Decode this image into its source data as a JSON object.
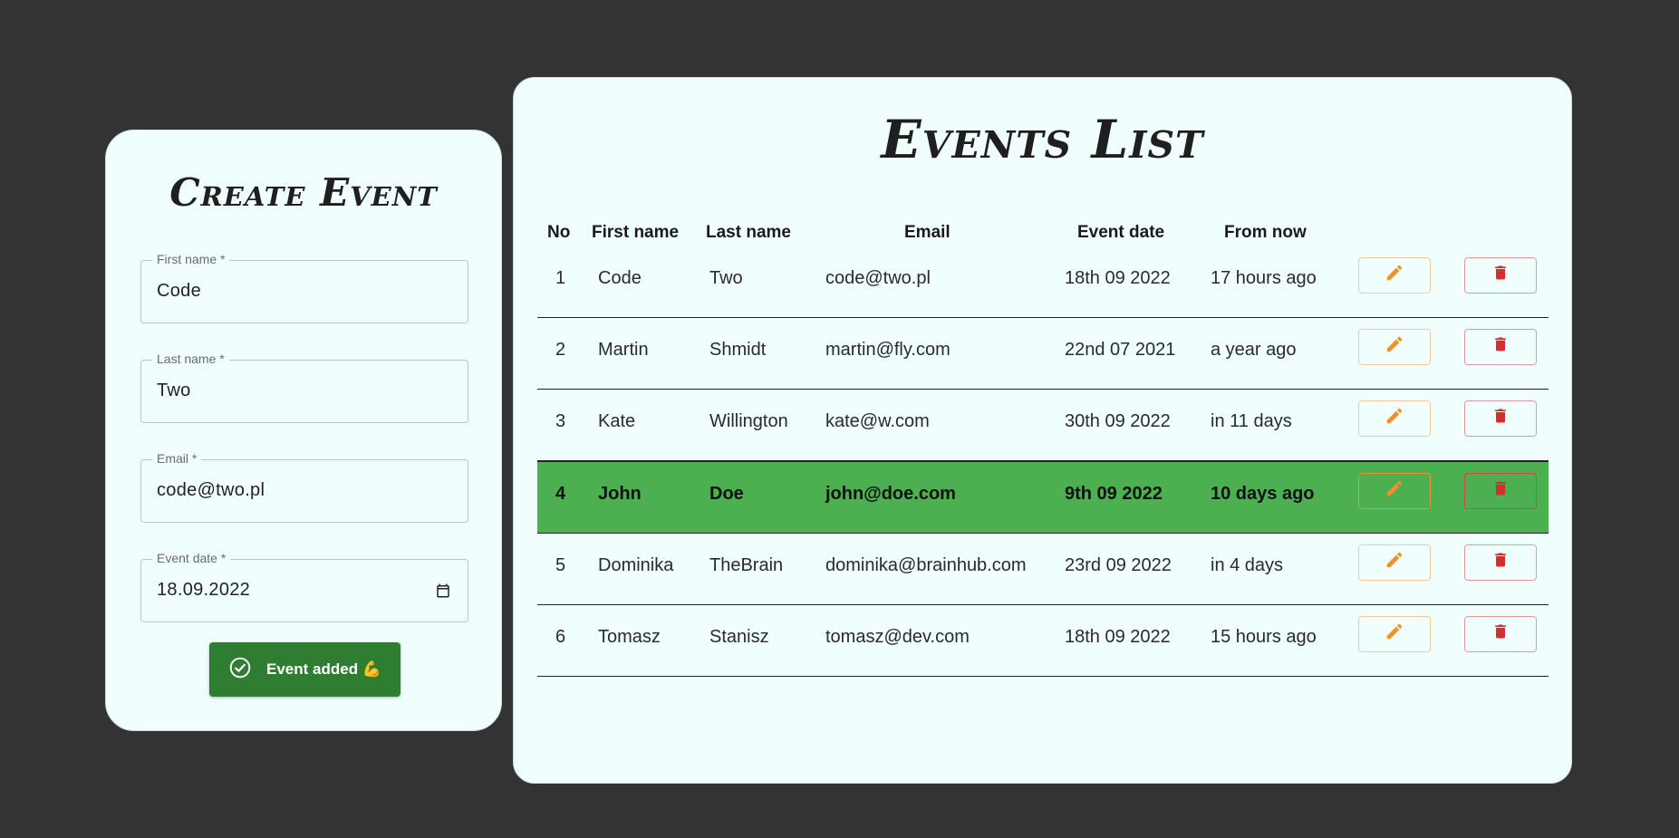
{
  "create_form": {
    "title": "Create Event",
    "fields": [
      {
        "label": "First name *",
        "value": "Code"
      },
      {
        "label": "Last name *",
        "value": "Two"
      },
      {
        "label": "Email *",
        "value": "code@two.pl"
      },
      {
        "label": "Event date *",
        "value": "18.09.2022"
      }
    ],
    "submit_label": "Event added 💪",
    "submit_icon": "check-circle-icon",
    "date_icon": "calendar-icon"
  },
  "events_list": {
    "title": "Events List",
    "headers": [
      "No",
      "First name",
      "Last name",
      "Email",
      "Event date",
      "From now"
    ],
    "rows": [
      {
        "no": "1",
        "first": "Code",
        "last": "Two",
        "email": "code@two.pl",
        "date": "18th 09 2022",
        "from_now": "17 hours ago"
      },
      {
        "no": "2",
        "first": "Martin",
        "last": "Shmidt",
        "email": "martin@fly.com",
        "date": "22nd 07 2021",
        "from_now": "a year ago"
      },
      {
        "no": "3",
        "first": "Kate",
        "last": "Willington",
        "email": "kate@w.com",
        "date": "30th 09 2022",
        "from_now": "in 11 days"
      },
      {
        "no": "4",
        "first": "John",
        "last": "Doe",
        "email": "john@doe.com",
        "date": "9th 09 2022",
        "from_now": "10 days ago"
      },
      {
        "no": "5",
        "first": "Dominika",
        "last": "TheBrain",
        "email": "dominika@brainhub.com",
        "date": "23rd 09 2022",
        "from_now": "in 4 days"
      },
      {
        "no": "6",
        "first": "Tomasz",
        "last": "Stanisz",
        "email": "tomasz@dev.com",
        "date": "18th 09 2022",
        "from_now": "15 hours ago"
      }
    ],
    "highlighted_row": 3,
    "edit_icon": "pencil-icon",
    "delete_icon": "trash-icon"
  },
  "colors": {
    "background": "#333333",
    "card": "#f0fffe",
    "submit": "#2e7d32",
    "highlight": "#4caf50",
    "edit": "#f0912a",
    "delete": "#d32f2f"
  }
}
